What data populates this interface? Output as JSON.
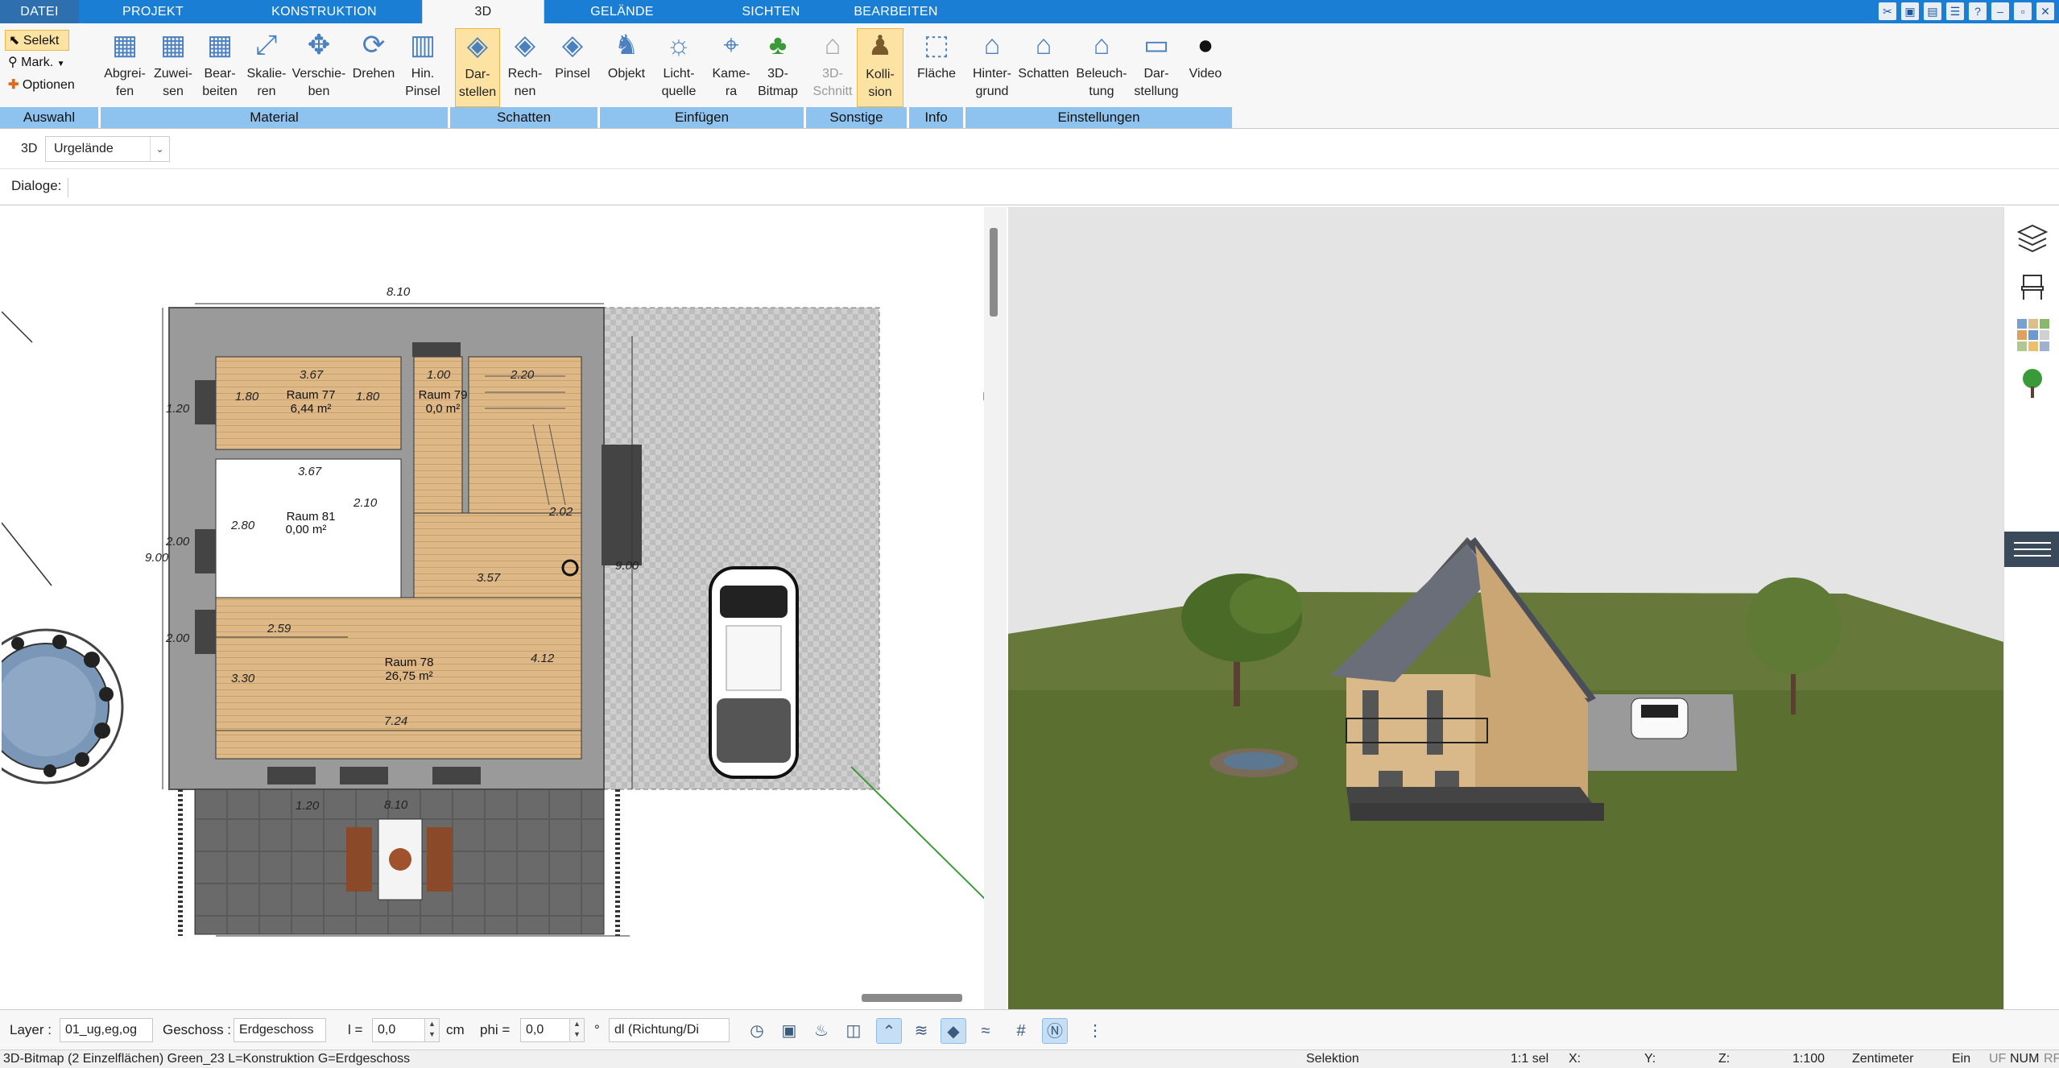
{
  "menu": {
    "tabs": [
      "DATEI",
      "PROJEKT",
      "KONSTRUKTION",
      "3D",
      "GELÄNDE",
      "SICHTEN",
      "BEARBEITEN"
    ],
    "active": "3D"
  },
  "ribbon": {
    "selection": {
      "select_label": "Selekt",
      "mark_label": "Mark.",
      "options_label": "Optionen",
      "group": "Auswahl"
    },
    "material": {
      "items": [
        "Abgrei-\nfen",
        "Zuwei-\nsen",
        "Bear-\nbeiten",
        "Skalie-\nren",
        "Verschie-\nben",
        "Drehen",
        "Hin.\nPinsel"
      ],
      "group": "Material"
    },
    "schatten": {
      "items": [
        "Dar-\nstellen",
        "Rech-\nnen",
        "Pinsel"
      ],
      "group": "Schatten"
    },
    "einfuegen": {
      "items": [
        "Objekt",
        "Licht-\nquelle",
        "Kame-\nra",
        "3D-\nBitmap"
      ],
      "group": "Einfügen"
    },
    "sonstige": {
      "items": [
        "3D-\nSchnitt",
        "Kolli-\nsion"
      ],
      "group": "Sonstige"
    },
    "info": {
      "items": [
        "Fläche"
      ],
      "group": "Info"
    },
    "einstellungen": {
      "items": [
        "Hinter-\ngrund",
        "Schatten",
        "Beleuch-\ntung",
        "Dar-\nstellung",
        "Video"
      ],
      "group": "Einstellungen"
    }
  },
  "toolbar3d": {
    "label": "3D",
    "selected": "Urgelände"
  },
  "dialogs": {
    "label": "Dialoge:"
  },
  "plan": {
    "dimensions": [
      "8.10",
      "3.67",
      "1.00",
      "2.20",
      "1.80",
      "1.80",
      "3.67",
      "2.80",
      "2.10",
      "3.57",
      "2.59",
      "3.30",
      "4.12",
      "7.24",
      "9.00",
      "9.00",
      "8.10",
      "2.02",
      "1.20",
      "1.20",
      "2.00",
      "2.00"
    ],
    "rooms": [
      {
        "name": "Raum 77",
        "area": "6,44 m²"
      },
      {
        "name": "Raum 79",
        "area": "0,0 m²"
      },
      {
        "name": "Raum 81",
        "area": "0,00 m²"
      },
      {
        "name": "Raum 78",
        "area": "26,75 m²"
      }
    ]
  },
  "bottombar": {
    "layer_label": "Layer :",
    "layer_value": "01_ug,eg,og",
    "geschoss_label": "Geschoss :",
    "geschoss_value": "Erdgeschoss",
    "l_label": "l =",
    "l_value": "0,0",
    "l_unit": "cm",
    "phi_label": "phi =",
    "phi_value": "0,0",
    "phi_unit": "°",
    "dl_value": "dl (Richtung/Di"
  },
  "status": {
    "left": "3D-Bitmap (2 Einzelflächen) Green_23 L=Konstruktion G=Erdgeschoss",
    "mode": "Selektion",
    "sel": "1:1 sel",
    "x": "X:",
    "y": "Y:",
    "z": "Z:",
    "scale": "1:100",
    "unit": "Zentimeter",
    "ein": "Ein",
    "uf": "UF",
    "num": "NUM",
    "rf": "RF"
  }
}
